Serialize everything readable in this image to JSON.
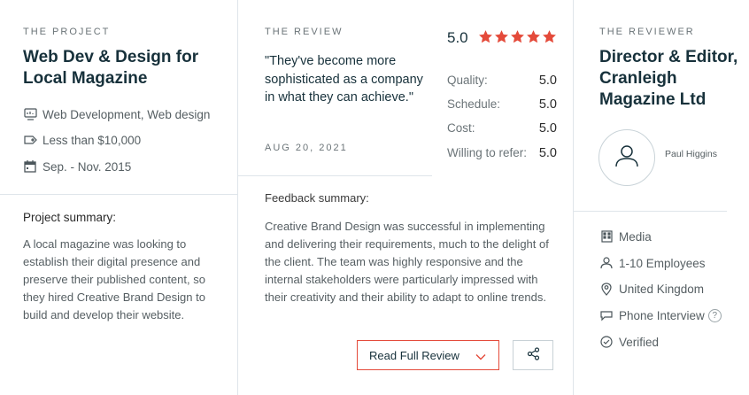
{
  "project": {
    "eyebrow": "THE PROJECT",
    "title": "Web Dev & Design for Local Magazine",
    "service": "Web Development, Web design",
    "budget": "Less than $10,000",
    "dates": "Sep. - Nov. 2015",
    "summary_head": "Project summary:",
    "summary_text": "A local magazine was looking to establish their digital presence and preserve their published content, so they hired Creative Brand Design to build and develop their website."
  },
  "review": {
    "eyebrow": "THE REVIEW",
    "quote": "\"They've become more sophisticated as a company in what they can achieve.\"",
    "date": "AUG 20, 2021",
    "overall": "5.0",
    "stars": 5,
    "star_color": "#e44a3a",
    "ratings": [
      {
        "label": "Quality:",
        "value": "5.0"
      },
      {
        "label": "Schedule:",
        "value": "5.0"
      },
      {
        "label": "Cost:",
        "value": "5.0"
      },
      {
        "label": "Willing to refer:",
        "value": "5.0"
      }
    ],
    "feedback_head": "Feedback summary:",
    "feedback_text": "Creative Brand Design was successful in implementing and delivering their requirements, much to the delight of the client. The team was highly responsive and the internal stakeholders were particularly impressed with their creativity and their ability to adapt to online trends.",
    "read_label": "Read Full Review",
    "accent": "#e44a3a"
  },
  "reviewer": {
    "eyebrow": "THE REVIEWER",
    "title": "Director & Editor, Cranleigh Magazine Ltd",
    "name": "Paul Higgins",
    "industry": "Media",
    "employees": "1-10 Employees",
    "location": "United Kingdom",
    "interview": "Phone Interview",
    "verified": "Verified",
    "help_glyph": "?"
  }
}
